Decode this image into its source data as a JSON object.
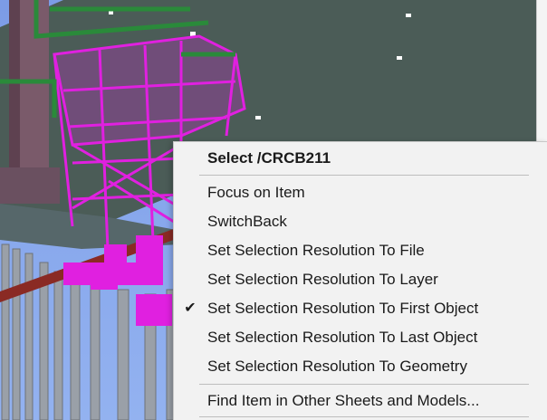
{
  "context_menu": {
    "header": "Select /CRCB211",
    "items": [
      {
        "label": "Focus on Item",
        "checked": false
      },
      {
        "label": "SwitchBack",
        "checked": false
      },
      {
        "label": "Set Selection Resolution To File",
        "checked": false
      },
      {
        "label": "Set Selection Resolution To Layer",
        "checked": false
      },
      {
        "label": "Set Selection Resolution To First Object",
        "checked": true
      },
      {
        "label": "Set Selection Resolution To Last Object",
        "checked": false
      },
      {
        "label": "Set Selection Resolution To Geometry",
        "checked": false
      }
    ],
    "footer": "Find Item in Other Sheets and Models...",
    "check_glyph": "✔"
  },
  "colors": {
    "background_sky": "#86a6ec",
    "deck_plate": "#4a5a56",
    "highlight_magenta": "#e020e0",
    "pipe_green": "#2a8a3a",
    "column_mauve": "#7a5a6a",
    "menu_background": "#f2f2f2"
  }
}
